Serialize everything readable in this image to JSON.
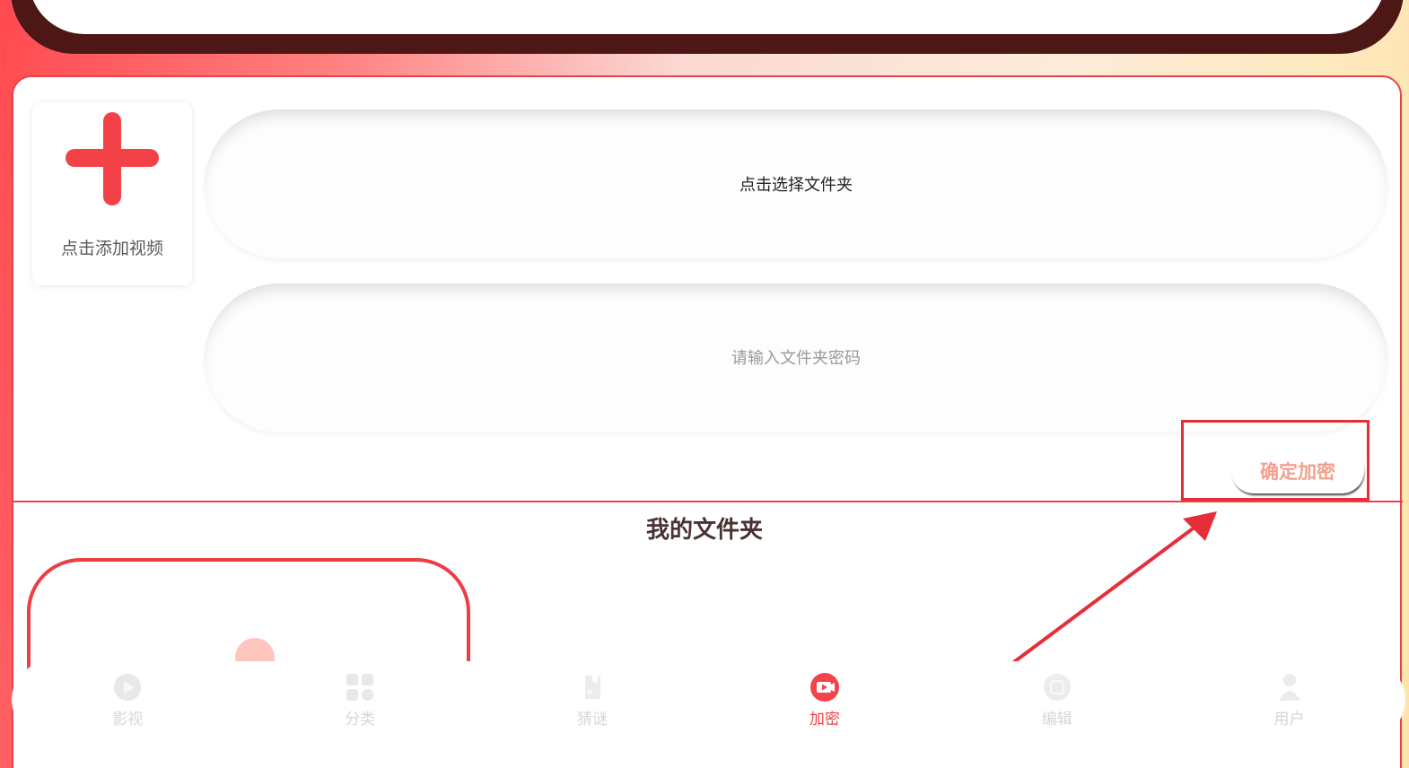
{
  "upload": {
    "add_video_label": "点击添加视频"
  },
  "form": {
    "folder_select_label": "点击选择文件夹",
    "password_placeholder": "请输入文件夹密码",
    "confirm_label": "确定加密"
  },
  "folders": {
    "title": "我的文件夹"
  },
  "tabbar": {
    "active_index": 3,
    "tabs": [
      {
        "label": "影视",
        "icon": "play-circle-icon"
      },
      {
        "label": "分类",
        "icon": "grid-icon"
      },
      {
        "label": "猜谜",
        "icon": "puzzle-icon"
      },
      {
        "label": "加密",
        "icon": "video-lock-icon"
      },
      {
        "label": "编辑",
        "icon": "edit-icon"
      },
      {
        "label": "用户",
        "icon": "user-icon"
      }
    ]
  },
  "colors": {
    "accent": "#f2444a",
    "annotation": "#e62e38",
    "confirm_text": "#f4a08e",
    "inactive_tab": "#d6d6d6"
  }
}
